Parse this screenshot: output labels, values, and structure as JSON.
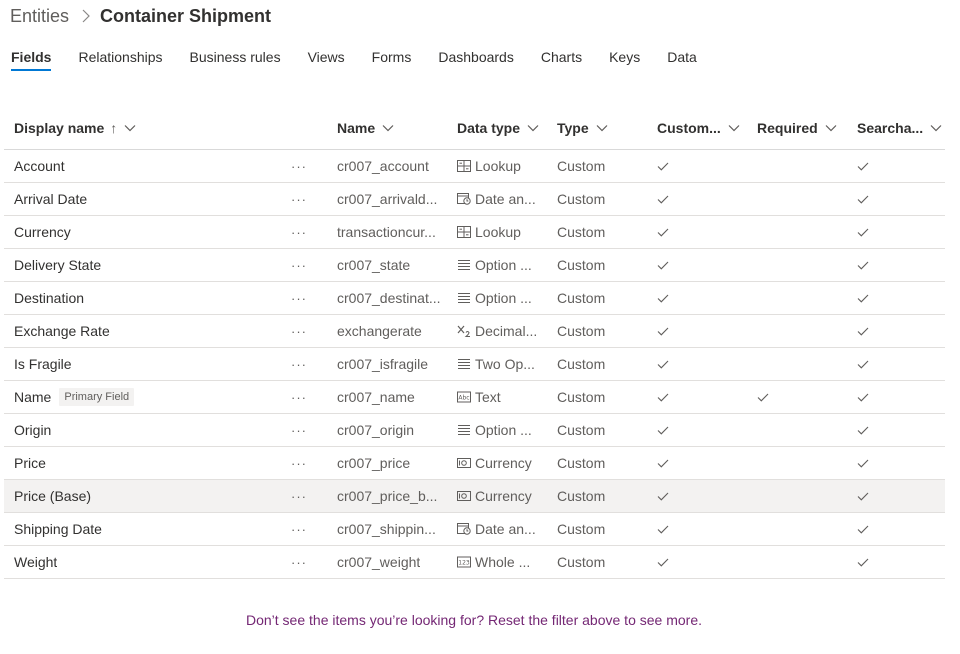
{
  "breadcrumb": {
    "root": "Entities",
    "current": "Container Shipment"
  },
  "tabs": [
    {
      "label": "Fields",
      "active": true
    },
    {
      "label": "Relationships"
    },
    {
      "label": "Business rules"
    },
    {
      "label": "Views"
    },
    {
      "label": "Forms"
    },
    {
      "label": "Dashboards"
    },
    {
      "label": "Charts"
    },
    {
      "label": "Keys"
    },
    {
      "label": "Data"
    }
  ],
  "columns": {
    "display_name": "Display name",
    "sort_indicator": "↑",
    "name": "Name",
    "data_type": "Data type",
    "type": "Type",
    "customizable": "Custom...",
    "required": "Required",
    "searchable": "Searcha..."
  },
  "row_more_label": "···",
  "rows": [
    {
      "display": "Account",
      "name": "cr007_account",
      "dtype": "Lookup",
      "dtype_icon": "lookup",
      "type": "Custom",
      "customizable": true,
      "required": false,
      "searchable": true
    },
    {
      "display": "Arrival Date",
      "name": "cr007_arrivald...",
      "dtype": "Date an...",
      "dtype_icon": "date",
      "type": "Custom",
      "customizable": true,
      "required": false,
      "searchable": true
    },
    {
      "display": "Currency",
      "name": "transactioncur...",
      "dtype": "Lookup",
      "dtype_icon": "lookup",
      "type": "Custom",
      "customizable": true,
      "required": false,
      "searchable": true
    },
    {
      "display": "Delivery State",
      "name": "cr007_state",
      "dtype": "Option ...",
      "dtype_icon": "option",
      "type": "Custom",
      "customizable": true,
      "required": false,
      "searchable": true
    },
    {
      "display": "Destination",
      "name": "cr007_destinat...",
      "dtype": "Option ...",
      "dtype_icon": "option",
      "type": "Custom",
      "customizable": true,
      "required": false,
      "searchable": true
    },
    {
      "display": "Exchange Rate",
      "name": "exchangerate",
      "dtype": "Decimal...",
      "dtype_icon": "decimal",
      "type": "Custom",
      "customizable": true,
      "required": false,
      "searchable": true
    },
    {
      "display": "Is Fragile",
      "name": "cr007_isfragile",
      "dtype": "Two Op...",
      "dtype_icon": "option",
      "type": "Custom",
      "customizable": true,
      "required": false,
      "searchable": true
    },
    {
      "display": "Name",
      "badge": "Primary Field",
      "name": "cr007_name",
      "dtype": "Text",
      "dtype_icon": "text",
      "type": "Custom",
      "customizable": true,
      "required": true,
      "searchable": true
    },
    {
      "display": "Origin",
      "name": "cr007_origin",
      "dtype": "Option ...",
      "dtype_icon": "option",
      "type": "Custom",
      "customizable": true,
      "required": false,
      "searchable": true
    },
    {
      "display": "Price",
      "name": "cr007_price",
      "dtype": "Currency",
      "dtype_icon": "currency",
      "type": "Custom",
      "customizable": true,
      "required": false,
      "searchable": true
    },
    {
      "display": "Price (Base)",
      "name": "cr007_price_b...",
      "dtype": "Currency",
      "dtype_icon": "currency",
      "type": "Custom",
      "customizable": true,
      "required": false,
      "searchable": true,
      "highlighted": true
    },
    {
      "display": "Shipping Date",
      "name": "cr007_shippin...",
      "dtype": "Date an...",
      "dtype_icon": "date",
      "type": "Custom",
      "customizable": true,
      "required": false,
      "searchable": true
    },
    {
      "display": "Weight",
      "name": "cr007_weight",
      "dtype": "Whole ...",
      "dtype_icon": "whole-number",
      "type": "Custom",
      "customizable": true,
      "required": false,
      "searchable": true
    }
  ],
  "footer_message": "Don’t see the items you’re looking for? Reset the filter above to see more.",
  "colors": {
    "accent": "#0078d4",
    "footer_link": "#742774",
    "row_highlight": "#f3f2f1"
  }
}
